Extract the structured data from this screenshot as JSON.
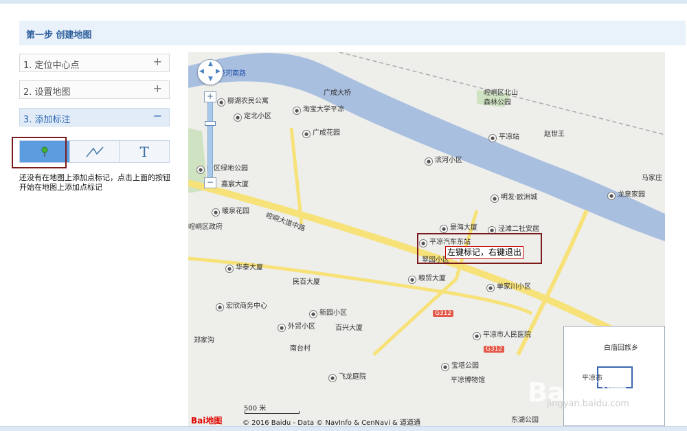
{
  "step_header": {
    "title": "第一步 创建地图"
  },
  "accordion": [
    {
      "label": "1. 定位中心点",
      "sign": "+"
    },
    {
      "label": "2. 设置地图",
      "sign": "+"
    },
    {
      "label": "3. 添加标注",
      "sign": "−"
    }
  ],
  "tools": {
    "text_tool": "T"
  },
  "hint": "还没有在地图上添加点标记，点击上面的按钮开始在地图上添加点标记",
  "map": {
    "labels": [
      {
        "text": "泾河南路",
        "style": "blue"
      },
      {
        "text": "柳湖农民公寓",
        "poi": true
      },
      {
        "text": "淘宝大学平凉",
        "poi": true
      },
      {
        "text": "广成大桥"
      },
      {
        "text": "崆峒区北山"
      },
      {
        "text": "森林公园"
      },
      {
        "text": "定北小区",
        "poi": true
      },
      {
        "text": "广成花园",
        "poi": true
      },
      {
        "text": "平凉站",
        "poi": true
      },
      {
        "text": "赵世王"
      },
      {
        "text": "滨河小区",
        "poi": true
      },
      {
        "text": "新区绿地公园",
        "poi": true
      },
      {
        "text": "嘉宸大厦"
      },
      {
        "text": "马家庄"
      },
      {
        "text": "明发·欧洲城",
        "poi": true
      },
      {
        "text": "龙泉家园",
        "poi": true
      },
      {
        "text": "暖泉花园",
        "poi": true
      },
      {
        "text": "崆峒区政府"
      },
      {
        "text": "崆峒大道中路"
      },
      {
        "text": "景海大厦",
        "poi": true
      },
      {
        "text": "泾滩二社安居",
        "poi": true
      },
      {
        "text": "平凉汽车东站",
        "poi": true
      },
      {
        "text": "翠园小区"
      },
      {
        "text": "华泰大厦",
        "poi": true
      },
      {
        "text": "民百大厦"
      },
      {
        "text": "粮贸大厦",
        "poi": true
      },
      {
        "text": "单家川小区",
        "poi": true
      },
      {
        "text": "宏欣商务中心",
        "poi": true
      },
      {
        "text": "新园小区",
        "poi": true
      },
      {
        "text": "外贸小区",
        "poi": true
      },
      {
        "text": "百兴大厦"
      },
      {
        "text": "平凉市人民医院",
        "poi": true
      },
      {
        "text": "郑家沟"
      },
      {
        "text": "南台村"
      },
      {
        "text": "宝塔公园",
        "poi": true
      },
      {
        "text": "飞龙庭院",
        "poi": true
      },
      {
        "text": "平凉博物馆"
      },
      {
        "text": "东湖公园"
      },
      {
        "text": "白庙回族乡"
      },
      {
        "text": "平凉市"
      }
    ],
    "road_shields": [
      "G312",
      "G312"
    ],
    "tooltip": "左键标记，右键退出",
    "scale_label": "500 米",
    "copyright": "© 2016 Baidu - Data © NavInfo & CenNavi & 道道通",
    "logo": "Bai地图",
    "watermark": "Bai经验",
    "watermark_url": "jingyan.baidu.com"
  },
  "colors": {
    "accent": "#2e67b3",
    "tool_active": "#5c9de0",
    "river": "#a9bfe0",
    "road": "#f7e27a",
    "highlight": "#7a1a1a",
    "tooltip_border": "#c40000"
  }
}
